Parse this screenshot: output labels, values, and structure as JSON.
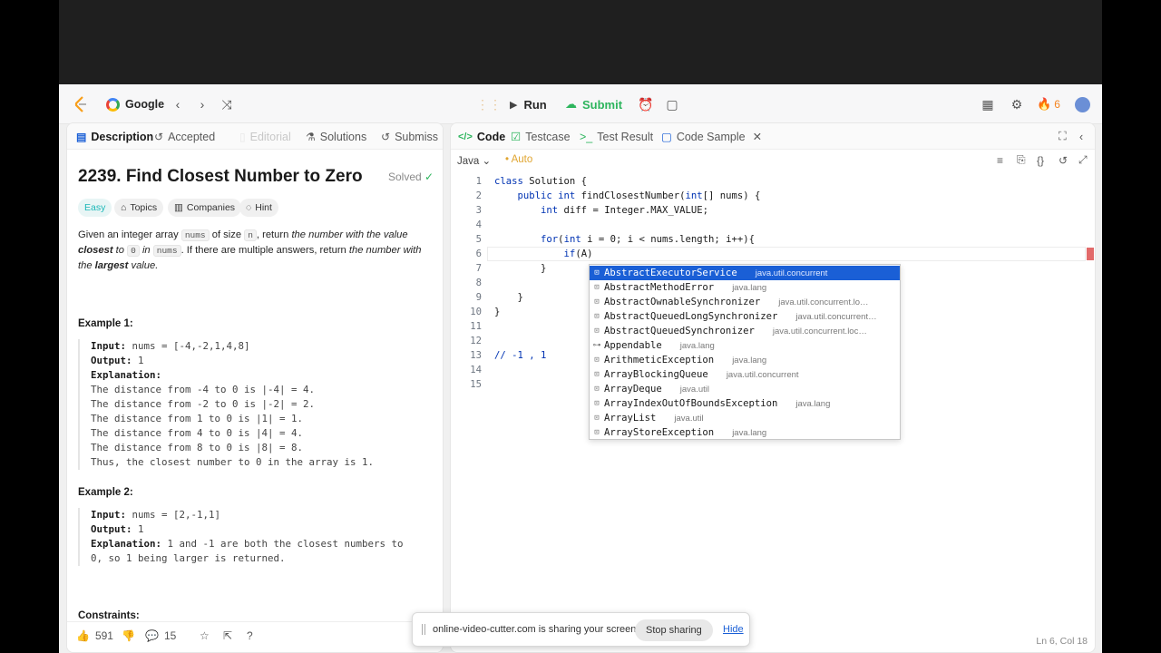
{
  "navbar": {
    "site": "Google",
    "run_label": "Run",
    "submit_label": "Submit",
    "streak": "6"
  },
  "left_tabs": [
    {
      "label": "Description"
    },
    {
      "label": "Accepted"
    },
    {
      "label": "Editorial"
    },
    {
      "label": "Solutions"
    },
    {
      "label": "Submiss"
    }
  ],
  "problem": {
    "title": "2239. Find Closest Number to Zero",
    "solved": "Solved",
    "chips": {
      "easy": "Easy",
      "topics": "Topics",
      "companies": "Companies",
      "hint": "Hint"
    },
    "p1": "Given an integer array",
    "p_nums": "nums",
    "p2": "of size",
    "p_n": "n",
    "p3": ", return",
    "p_em1": "the number with the value",
    "p_closest": "closest",
    "p_to": "to",
    "p_zero": "0",
    "p_in": "in",
    "p_nums2": "nums",
    "p4": ". If there are multiple answers, return",
    "p_em2": "the number with the",
    "p_largest": "largest",
    "p_value": "value."
  },
  "example1": {
    "title": "Example 1:",
    "input_label": "Input:",
    "input": "nums = [-4,-2,1,4,8]",
    "output_label": "Output:",
    "output": "1",
    "expl_label": "Explanation:",
    "lines": [
      "The distance from -4 to 0 is |-4| = 4.",
      "The distance from -2 to 0 is |-2| = 2.",
      "The distance from 1 to 0 is |1| = 1.",
      "The distance from 4 to 0 is |4| = 4.",
      "The distance from 8 to 0 is |8| = 8.",
      "Thus, the closest number to 0 in the array is 1."
    ]
  },
  "example2": {
    "title": "Example 2:",
    "input_label": "Input:",
    "input": "nums = [2,-1,1]",
    "output_label": "Output:",
    "output": "1",
    "expl_label": "Explanation:",
    "expl1": "1 and -1 are both the closest numbers to",
    "expl2": "0, so 1 being larger is returned."
  },
  "constraints_title": "Constraints:",
  "left_footer": {
    "likes": "591",
    "comments": "15"
  },
  "right_tabs": [
    {
      "label": "Code"
    },
    {
      "label": "Testcase"
    },
    {
      "label": "Test Result"
    },
    {
      "label": "Code Sample"
    }
  ],
  "editor": {
    "language": "Java",
    "auto": "Auto",
    "line_numbers": [
      "1",
      "2",
      "3",
      "4",
      "5",
      "6",
      "7",
      "8",
      "9",
      "10",
      "11",
      "12",
      "13",
      "14",
      "15"
    ],
    "cursor_pos": "Ln 6, Col 18"
  },
  "autocomplete": [
    {
      "name": "AbstractExecutorService",
      "pkg": "java.util.concurrent",
      "icon": "class-icon"
    },
    {
      "name": "AbstractMethodError",
      "pkg": "java.lang",
      "icon": "class-icon"
    },
    {
      "name": "AbstractOwnableSynchronizer",
      "pkg": "java.util.concurrent.lo…",
      "icon": "class-icon"
    },
    {
      "name": "AbstractQueuedLongSynchronizer",
      "pkg": "java.util.concurrent…",
      "icon": "class-icon"
    },
    {
      "name": "AbstractQueuedSynchronizer",
      "pkg": "java.util.concurrent.loc…",
      "icon": "class-icon"
    },
    {
      "name": "Appendable",
      "pkg": "java.lang",
      "icon": "interface-icon"
    },
    {
      "name": "ArithmeticException",
      "pkg": "java.lang",
      "icon": "class-icon"
    },
    {
      "name": "ArrayBlockingQueue",
      "pkg": "java.util.concurrent",
      "icon": "class-icon"
    },
    {
      "name": "ArrayDeque",
      "pkg": "java.util",
      "icon": "class-icon"
    },
    {
      "name": "ArrayIndexOutOfBoundsException",
      "pkg": "java.lang",
      "icon": "class-icon"
    },
    {
      "name": "ArrayList",
      "pkg": "java.util",
      "icon": "class-icon"
    },
    {
      "name": "ArrayStoreException",
      "pkg": "java.lang",
      "icon": "class-icon"
    }
  ],
  "sharebar": {
    "message": "online-video-cutter.com is sharing your screen.",
    "stop": "Stop sharing",
    "hide": "Hide"
  },
  "colors": {
    "accent": "#1a5fd6",
    "submit": "#2db55d",
    "easy": "#1cb8b8"
  }
}
